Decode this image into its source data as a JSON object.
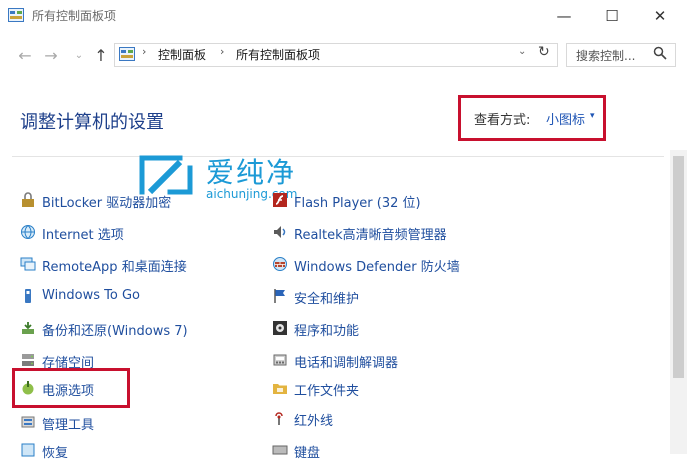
{
  "window": {
    "title": "所有控制面板项",
    "controls": {
      "minimize": "—",
      "maximize": "☐",
      "close": "✕"
    }
  },
  "nav": {
    "back": "←",
    "forward": "→",
    "recent": "⌄",
    "up": "↑",
    "separator": "›",
    "breadcrumbs": [
      "控制面板",
      "所有控制面板项"
    ],
    "dropdown": "⌄",
    "refresh": "↻",
    "search_placeholder": "搜索控制..."
  },
  "header": {
    "title": "调整计算机的设置",
    "view_by_label": "查看方式:",
    "view_by_value": "小图标",
    "view_by_caret": "▾"
  },
  "watermark": {
    "name": "爱纯净",
    "url": "aichunjing.com"
  },
  "items_left": [
    {
      "label": "BitLocker 驱动器加密",
      "icon": "bitlocker-icon"
    },
    {
      "label": "Internet 选项",
      "icon": "internet-options-icon"
    },
    {
      "label": "RemoteApp 和桌面连接",
      "icon": "remoteapp-icon"
    },
    {
      "label": "Windows To Go",
      "icon": "windows-to-go-icon"
    },
    {
      "label": "备份和还原(Windows 7)",
      "icon": "backup-restore-icon"
    },
    {
      "label": "存储空间",
      "icon": "storage-spaces-icon"
    },
    {
      "label": "电源选项",
      "icon": "power-options-icon"
    },
    {
      "label": "管理工具",
      "icon": "admin-tools-icon"
    },
    {
      "label": "恢复",
      "icon": "recovery-icon"
    }
  ],
  "items_right": [
    {
      "label": "Flash Player (32 位)",
      "icon": "flash-player-icon"
    },
    {
      "label": "Realtek高清晰音频管理器",
      "icon": "realtek-audio-icon"
    },
    {
      "label": "Windows Defender 防火墙",
      "icon": "firewall-icon"
    },
    {
      "label": "安全和维护",
      "icon": "security-maintenance-icon"
    },
    {
      "label": "程序和功能",
      "icon": "programs-features-icon"
    },
    {
      "label": "电话和调制解调器",
      "icon": "phone-modem-icon"
    },
    {
      "label": "工作文件夹",
      "icon": "work-folders-icon"
    },
    {
      "label": "红外线",
      "icon": "infrared-icon"
    },
    {
      "label": "键盘",
      "icon": "keyboard-icon"
    }
  ],
  "colors": {
    "highlight_red": "#c8102e",
    "link_blue": "#1f4e9e",
    "heading_blue": "#1d3f8a",
    "watermark_blue": "#1c9ad6"
  }
}
